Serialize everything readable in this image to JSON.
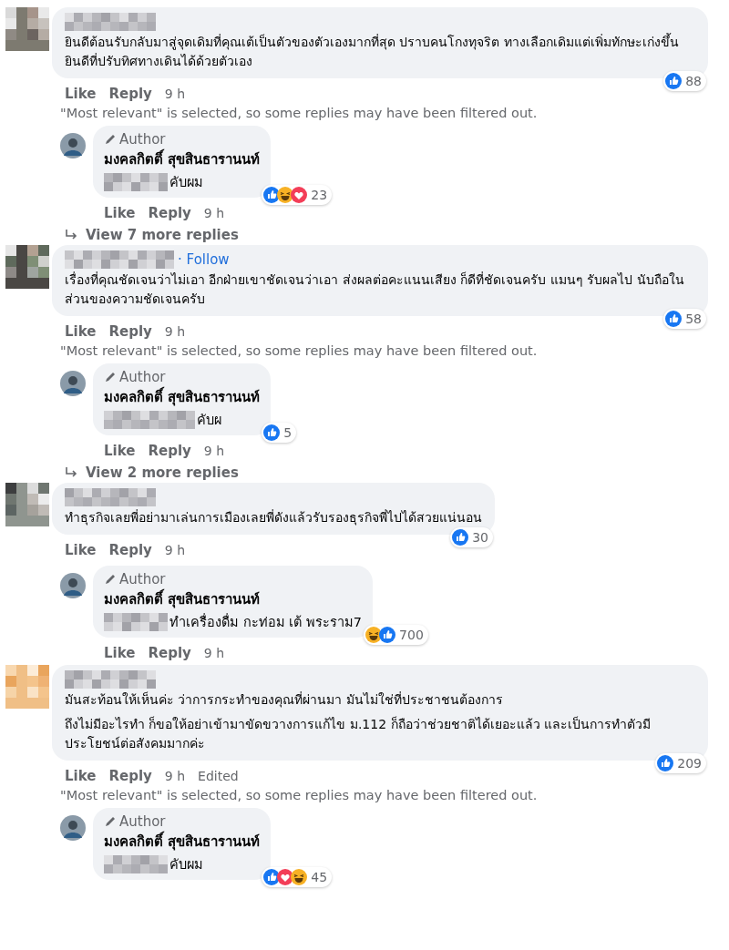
{
  "threads": [
    {
      "comment": {
        "paragraphs": [
          "ยินดีต้อนรับกลับมาสู่จุดเดิมที่คุณเต้เป็นตัวของตัวเองมากที่สุด ปราบคนโกงทุจริต ทางเลือกเดิมแต่เพิ่มทักษะเก่งขึ้น ยินดีที่ปรับทิศทางเดินได้ด้วยตัวเอง"
        ],
        "reactions": [
          {
            "kind": "like"
          }
        ],
        "reaction_count": "88",
        "actions": [
          {
            "kind": "link",
            "label": "Like"
          },
          {
            "kind": "link",
            "label": "Reply"
          },
          {
            "kind": "time",
            "label": "9 h"
          }
        ]
      },
      "filter_note": "\"Most relevant\" is selected, so some replies may have been filtered out.",
      "reply": {
        "badge": "Author",
        "name": "มงคลกิตติ์ สุขสินธารานนท์",
        "text": "คับผม",
        "reactions": [
          {
            "kind": "like"
          },
          {
            "kind": "haha"
          },
          {
            "kind": "love"
          }
        ],
        "reaction_count": "23",
        "actions": [
          {
            "kind": "link",
            "label": "Like"
          },
          {
            "kind": "link",
            "label": "Reply"
          },
          {
            "kind": "time",
            "label": "9 h"
          }
        ]
      },
      "view_more": "View 7 more replies"
    },
    {
      "comment": {
        "follow": "· Follow",
        "paragraphs": [
          "เรื่องที่คุณชัดเจนว่าไม่เอา อีกฝ่ายเขาชัดเจนว่าเอา ส่งผลต่อคะแนนเสียง ก็ดีที่ชัดเจนครับ แมนๆ รับผลไป นับถือในส่วนของความชัดเจนครับ"
        ],
        "reactions": [
          {
            "kind": "like"
          }
        ],
        "reaction_count": "58",
        "actions": [
          {
            "kind": "link",
            "label": "Like"
          },
          {
            "kind": "link",
            "label": "Reply"
          },
          {
            "kind": "time",
            "label": "9 h"
          }
        ]
      },
      "filter_note": "\"Most relevant\" is selected, so some replies may have been filtered out.",
      "reply": {
        "badge": "Author",
        "name": "มงคลกิตติ์ สุขสินธารานนท์",
        "text": "คับผ",
        "reactions": [
          {
            "kind": "like"
          }
        ],
        "reaction_count": "5",
        "actions": [
          {
            "kind": "link",
            "label": "Like"
          },
          {
            "kind": "link",
            "label": "Reply"
          },
          {
            "kind": "time",
            "label": "9 h"
          }
        ]
      },
      "view_more": "View 2 more replies"
    },
    {
      "comment": {
        "paragraphs": [
          "ทำธุรกิจเลยพี่อย่ามาเล่นการเมืองเลยพี่ดังแล้วรับรองธุรกิจพี่ไปได้สวยแน่นอน"
        ],
        "reactions": [
          {
            "kind": "like"
          }
        ],
        "reaction_count": "30",
        "actions": [
          {
            "kind": "link",
            "label": "Like"
          },
          {
            "kind": "link",
            "label": "Reply"
          },
          {
            "kind": "time",
            "label": "9 h"
          }
        ]
      },
      "reply": {
        "badge": "Author",
        "name": "มงคลกิตติ์ สุขสินธารานนท์",
        "text": "ทำเครื่องดื่ม กะท่อม เต้ พระราม7",
        "reactions": [
          {
            "kind": "haha"
          },
          {
            "kind": "like"
          }
        ],
        "reaction_count": "700",
        "actions": [
          {
            "kind": "link",
            "label": "Like"
          },
          {
            "kind": "link",
            "label": "Reply"
          },
          {
            "kind": "time",
            "label": "9 h"
          }
        ]
      }
    },
    {
      "comment": {
        "paragraphs": [
          "มันสะท้อนให้เห็นค่ะ ว่าการกระทำของคุณที่ผ่านมา มันไม่ใช่ที่ประชาชนต้องการ",
          "ถึงไม่มีอะไรทำ ก็ขอให้อย่าเข้ามาขัดขวางการแก้ไข ม.112 ก็ถือว่าช่วยชาติได้เยอะแล้ว และเป็นการทำตัวมีประโยชน์ต่อสังคมมากค่ะ"
        ],
        "reactions": [
          {
            "kind": "like"
          }
        ],
        "reaction_count": "209",
        "actions": [
          {
            "kind": "link",
            "label": "Like"
          },
          {
            "kind": "link",
            "label": "Reply"
          },
          {
            "kind": "time",
            "label": "9 h"
          },
          {
            "kind": "edited",
            "label": "Edited"
          }
        ]
      },
      "filter_note": "\"Most relevant\" is selected, so some replies may have been filtered out.",
      "reply": {
        "badge": "Author",
        "name": "มงคลกิตติ์ สุขสินธารานนท์",
        "text": "คับผม",
        "reactions": [
          {
            "kind": "like"
          },
          {
            "kind": "love"
          },
          {
            "kind": "haha"
          }
        ],
        "reaction_count": "45"
      }
    }
  ]
}
